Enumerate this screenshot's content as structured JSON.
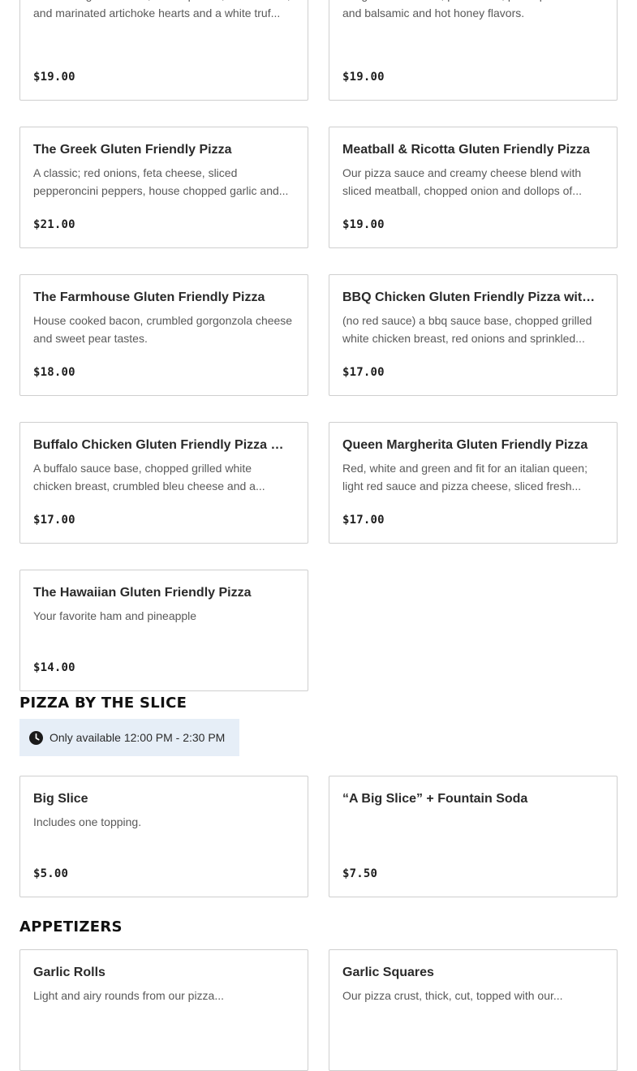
{
  "pizza_cards": [
    {
      "name": "",
      "description": "Crumbled goat cheese, fresh spinach, mushrooms, and marinated artichoke hearts and a white truf...",
      "price": "$19.00"
    },
    {
      "name": "",
      "description": "Gorgonzola cheese, pear slices, prime prosciutto and balsamic and hot honey flavors.",
      "price": "$19.00"
    },
    {
      "name": "The Greek Gluten Friendly Pizza",
      "description": "A classic; red onions, feta cheese, sliced pepperoncini peppers, house chopped garlic and...",
      "price": "$21.00"
    },
    {
      "name": "Meatball & Ricotta Gluten Friendly Pizza",
      "description": "Our pizza sauce and creamy cheese blend with sliced meatball, chopped onion and dollops of...",
      "price": "$19.00"
    },
    {
      "name": "The Farmhouse Gluten Friendly Pizza",
      "description": "House cooked bacon, crumbled gorgonzola cheese and sweet pear tastes.",
      "price": "$18.00"
    },
    {
      "name": "BBQ Chicken Gluten Friendly Pizza with N...",
      "description": "(no red sauce) a bbq sauce base, chopped grilled white chicken breast, red onions and sprinkled...",
      "price": "$17.00"
    },
    {
      "name": "Buffalo Chicken Gluten Friendly Pizza wit...",
      "description": "A buffalo sauce base, chopped grilled white chicken breast, crumbled bleu cheese and a...",
      "price": "$17.00"
    },
    {
      "name": "Queen Margherita Gluten Friendly Pizza",
      "description": "Red, white and green and fit for an italian queen; light red sauce and pizza cheese, sliced fresh...",
      "price": "$17.00"
    },
    {
      "name": "The Hawaiian Gluten Friendly Pizza",
      "description": "Your favorite ham and pineapple",
      "price": "$14.00"
    }
  ],
  "slice_section": {
    "heading": "PIZZA BY THE SLICE",
    "availability": "Only available 12:00 PM - 2:30 PM",
    "icon": "clock-icon",
    "items": [
      {
        "name": "Big Slice",
        "description": "Includes one topping.",
        "price": "$5.00"
      },
      {
        "name": "“A Big Slice” + Fountain Soda",
        "description": "",
        "price": "$7.50"
      }
    ]
  },
  "appetizers_section": {
    "heading": "APPETIZERS",
    "items": [
      {
        "name": "Garlic Rolls",
        "description": "Light and airy rounds from our pizza...",
        "price": ""
      },
      {
        "name": "Garlic Squares",
        "description": "Our pizza crust, thick, cut, topped with our...",
        "price": ""
      }
    ]
  },
  "colors": {
    "availability_bg": "#e6eef7",
    "card_border": "#cfcfcf"
  }
}
